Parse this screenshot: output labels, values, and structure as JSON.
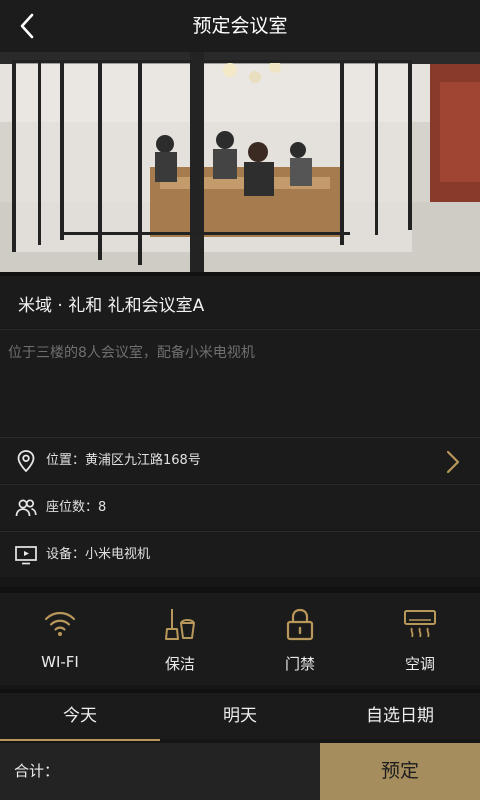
{
  "header": {
    "title": "预定会议室",
    "back_icon": "chevron-left-icon"
  },
  "room": {
    "name": "米域 · 礼和 礼和会议室A",
    "description": "位于三楼的8人会议室，配备小米电视机"
  },
  "info": [
    {
      "icon": "location-pin-icon",
      "label": "位置：黄浦区九江路168号",
      "has_arrow": true
    },
    {
      "icon": "people-icon",
      "label": "座位数：8",
      "has_arrow": false
    },
    {
      "icon": "monitor-icon",
      "label": "设备：小米电视机",
      "has_arrow": false
    }
  ],
  "amenities": [
    {
      "icon": "wifi-icon",
      "label": "WI-FI"
    },
    {
      "icon": "cleaning-icon",
      "label": "保洁"
    },
    {
      "icon": "lock-icon",
      "label": "门禁"
    },
    {
      "icon": "air-conditioner-icon",
      "label": "空调"
    }
  ],
  "date_tabs": {
    "active": "今天",
    "items": [
      "今天",
      "明天",
      "自选日期"
    ]
  },
  "footer": {
    "total_label": "合计：",
    "book_label": "预定"
  },
  "colors": {
    "accent": "#b8975a",
    "book_button": "#a68d5e",
    "background": "#161616",
    "panel": "#1b1b1b"
  }
}
